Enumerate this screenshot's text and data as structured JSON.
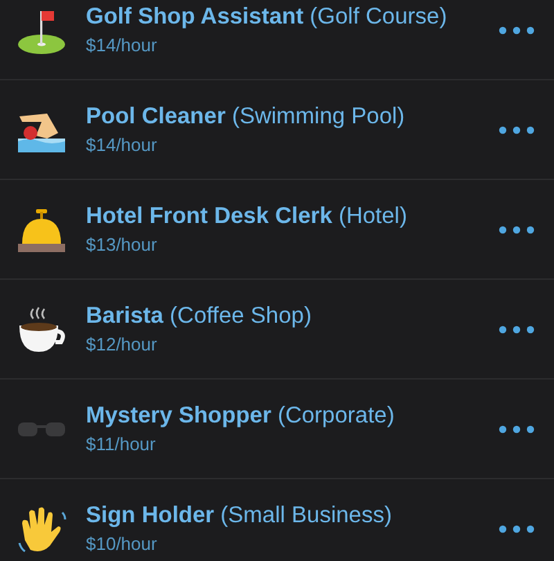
{
  "jobs": [
    {
      "kind": "golf",
      "title": "Golf Shop Assistant",
      "place": "(Golf Course)",
      "wage": "$14/hour"
    },
    {
      "kind": "swimmer",
      "title": "Pool Cleaner",
      "place": "(Swimming Pool)",
      "wage": "$14/hour"
    },
    {
      "kind": "bell",
      "title": "Hotel Front Desk Clerk",
      "place": "(Hotel)",
      "wage": "$13/hour"
    },
    {
      "kind": "coffee",
      "title": "Barista",
      "place": "(Coffee Shop)",
      "wage": "$12/hour"
    },
    {
      "kind": "sunglasses",
      "title": "Mystery Shopper",
      "place": "(Corporate)",
      "wage": "$11/hour"
    },
    {
      "kind": "hand",
      "title": "Sign Holder",
      "place": "(Small Business)",
      "wage": "$10/hour"
    }
  ]
}
